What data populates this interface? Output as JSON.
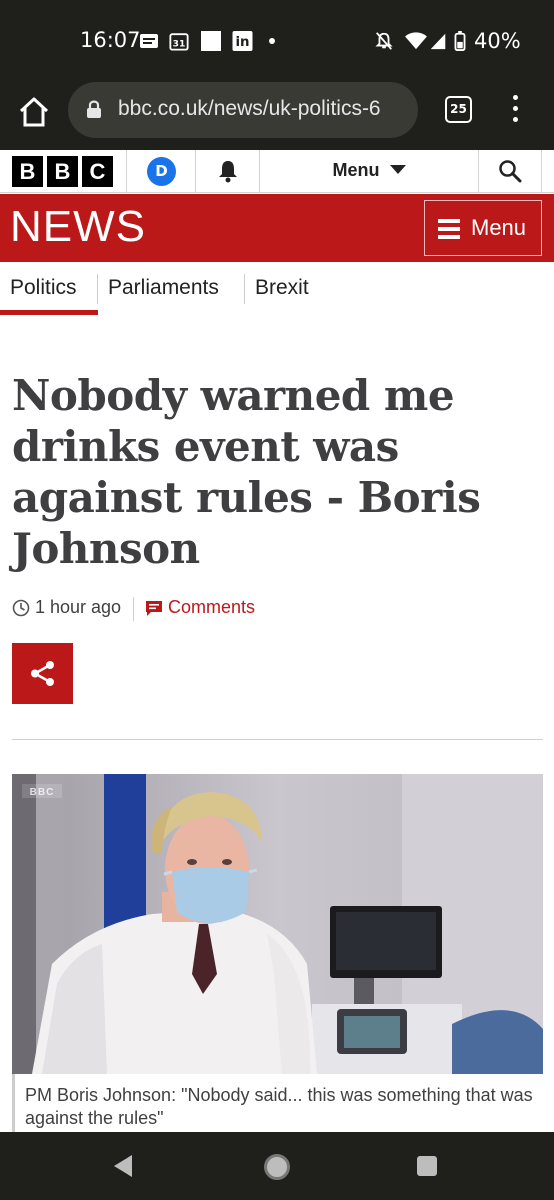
{
  "status_bar": {
    "time": "16:07",
    "battery": "40%",
    "icons": [
      "message-icon",
      "calendar-icon",
      "square-icon",
      "linkedin-icon",
      "dot-icon",
      "mute-icon",
      "wifi-icon",
      "signal-icon",
      "battery-icon"
    ],
    "calendar_day": "31",
    "linkedin": "in"
  },
  "browser": {
    "url": "bbc.co.uk/news/uk-politics-6",
    "tab_count": "25"
  },
  "bbc_nav": {
    "logo_letters": [
      "B",
      "B",
      "C"
    ],
    "account_initial": "D",
    "menu_label": "Menu"
  },
  "news_bar": {
    "logo": "NEWS",
    "menu_label": "Menu"
  },
  "section_nav": {
    "items": [
      "Politics",
      "Parliaments",
      "Brexit"
    ],
    "active": "Politics"
  },
  "article": {
    "headline": "Nobody warned me drinks event was against rules - Boris Johnson",
    "time_ago": "1 hour ago",
    "comments_label": "Comments",
    "image_watermark": "BBC",
    "caption": "PM Boris Johnson: \"Nobody said... this was something that was against the rules\""
  },
  "colors": {
    "bbc_red": "#bb1919",
    "headline": "#3f3f42",
    "system_bar": "#1f1f1b"
  }
}
